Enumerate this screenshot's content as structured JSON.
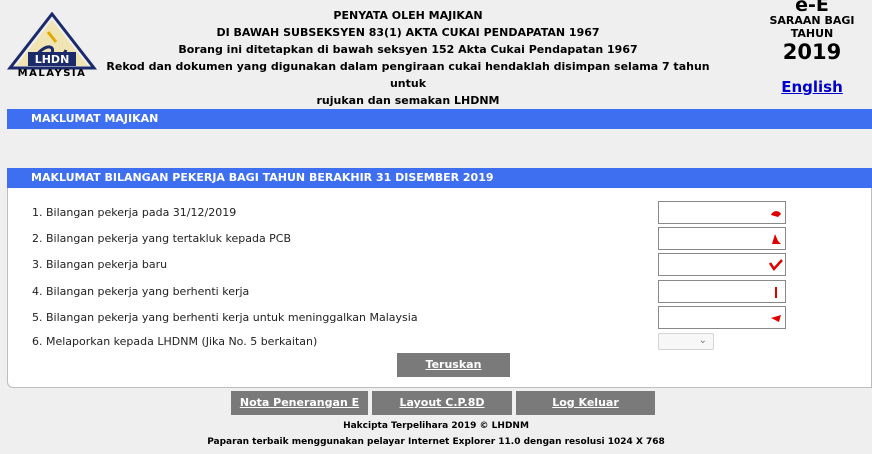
{
  "header": {
    "logo_text": "MALAYSIA",
    "logo_mark": "LHDN",
    "lines": [
      "PENYATA OLEH MAJIKAN",
      "DI BAWAH SUBSEKSYEN 83(1) AKTA CUKAI PENDAPATAN 1967",
      "Borang ini ditetapkan di bawah seksyen 152 Akta Cukai Pendapatan 1967",
      "Rekod dan dokumen yang digunakan dalam pengiraan cukai hendaklah disimpan selama 7 tahun untuk",
      "rujukan dan semakan LHDNM"
    ],
    "form_code": "e-E",
    "saraan_label": "SARAAN BAGI",
    "tahun_label": "TAHUN",
    "year": "2019",
    "language_link": "English"
  },
  "sections": {
    "employer": "MAKLUMAT MAJIKAN",
    "employees": "MAKLUMAT BILANGAN PEKERJA BAGI TAHUN BERAKHIR 31 DISEMBER 2019"
  },
  "form": {
    "rows": [
      {
        "label": "1. Bilangan pekerja pada 31/12/2019",
        "value": ""
      },
      {
        "label": "2. Bilangan pekerja yang tertakluk kepada PCB",
        "value": ""
      },
      {
        "label": "3. Bilangan pekerja baru",
        "value": ""
      },
      {
        "label": "4. Bilangan pekerja yang berhenti kerja",
        "value": ""
      },
      {
        "label": "5. Bilangan pekerja yang berhenti kerja untuk meninggalkan Malaysia",
        "value": ""
      }
    ],
    "report_label": "6. Melaporkan kepada LHDNM (Jika No. 5 berkaitan)",
    "report_selected": "",
    "submit_label": "Teruskan"
  },
  "nav": {
    "notes": "Nota Penerangan E",
    "layout": "Layout C.P.8D",
    "logout": "Log Keluar"
  },
  "footer": {
    "copyright": "Hakcipta Terpelihara 2019 © LHDNM",
    "browser_note": "Paparan terbaik menggunakan pelayar Internet Explorer 11.0 dengan resolusi 1024 X 768"
  },
  "colors": {
    "bar": "#3e6ff0",
    "button": "#7a7a7a",
    "link": "#0000cc",
    "mark": "#e00000"
  }
}
